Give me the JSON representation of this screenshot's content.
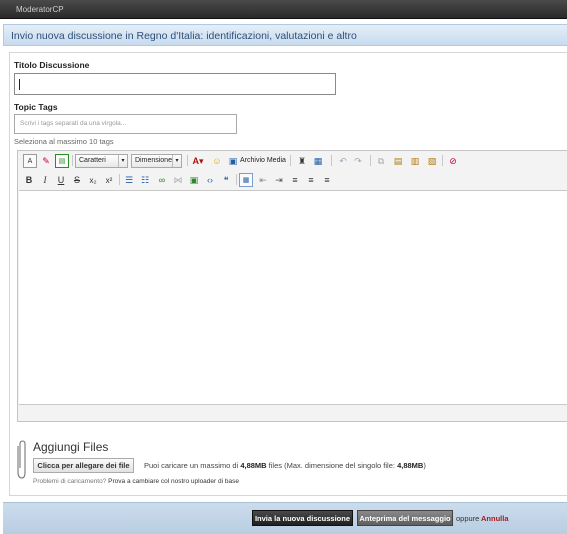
{
  "topbar": {
    "label": "ModeratorCP"
  },
  "header": {
    "title": "Invio nuova discussione in Regno d'Italia: identificazioni, valutazioni e altro"
  },
  "form": {
    "title_label": "Titolo Discussione",
    "title_value": "",
    "tags_label": "Topic Tags",
    "tags_placeholder": "Scrivi i tags separati da una virgola...",
    "tags_hint": "Seleziona al massimo 10 tags"
  },
  "editor": {
    "font_select": "Caratteri",
    "size_select": "Dimensione",
    "media_label": "Archivio Media",
    "body_value": ""
  },
  "attachments": {
    "heading": "Aggiungi Files",
    "upload_button": "Clicca per allegare dei file",
    "info_prefix": "Puoi caricare un massimo di",
    "max_total": "4,88MB",
    "info_mid": "files (Max. dimensione del singolo file:",
    "max_single": "4,88MB",
    "info_suffix": ")",
    "problems_text": "Problemi di caricamento?",
    "problems_link": "Prova a cambiare col nostro uploader di base"
  },
  "actions": {
    "submit": "Invia la nuova discussione",
    "preview": "Anteprima del messaggio",
    "or": "oppure",
    "cancel": "Annulla"
  },
  "colors": {
    "header_text": "#2f4f78",
    "cancel": "#a41c1c"
  }
}
